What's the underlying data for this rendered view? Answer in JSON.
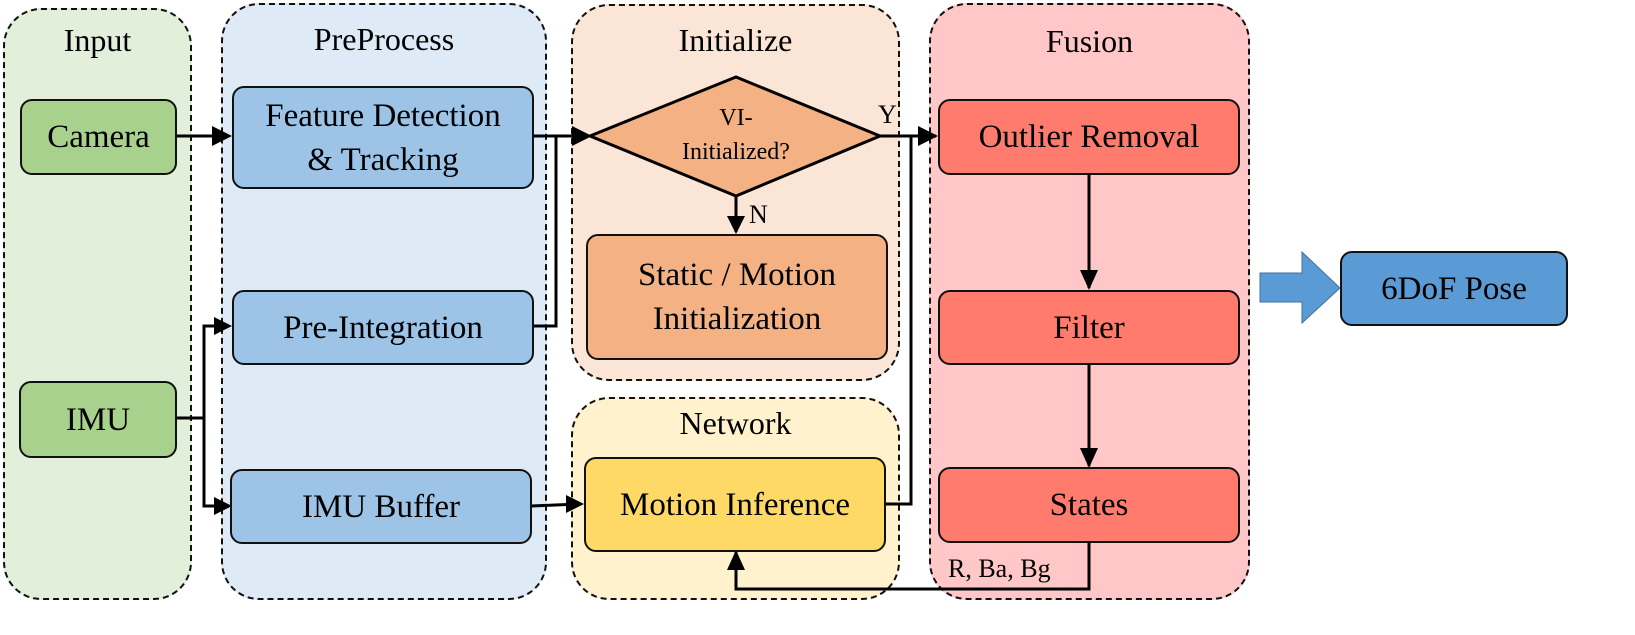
{
  "colors": {
    "input_bg": "#e2efda",
    "input_node": "#a9d18e",
    "preprocess_bg": "#deebf7",
    "preprocess_node": "#9dc3e6",
    "initialize_bg": "#fbe5d6",
    "initialize_node": "#f4b183",
    "network_bg": "#fff2cc",
    "network_node": "#ffd966",
    "fusion_bg": "#ffc7c7",
    "fusion_node": "#ff7b6e",
    "output_node": "#5b9bd5"
  },
  "groups": {
    "input": {
      "title": "Input",
      "nodes": {
        "camera": "Camera",
        "imu": "IMU"
      }
    },
    "preprocess": {
      "title": "PreProcess",
      "nodes": {
        "feature": "Feature Detection\n& Tracking",
        "preint": "Pre-Integration",
        "buffer": "IMU Buffer"
      }
    },
    "initialize": {
      "title": "Initialize",
      "decision": "VI-\nInitialized?",
      "nodes": {
        "static": "Static / Motion\nInitialization"
      }
    },
    "network": {
      "title": "Network",
      "nodes": {
        "inference": "Motion Inference"
      }
    },
    "fusion": {
      "title": "Fusion",
      "nodes": {
        "outlier": "Outlier Removal",
        "filter": "Filter",
        "states": "States"
      }
    }
  },
  "output": {
    "label": "6DoF Pose"
  },
  "edge_labels": {
    "yes": "Y",
    "no": "N",
    "feedback": "R, Ba, Bg"
  }
}
